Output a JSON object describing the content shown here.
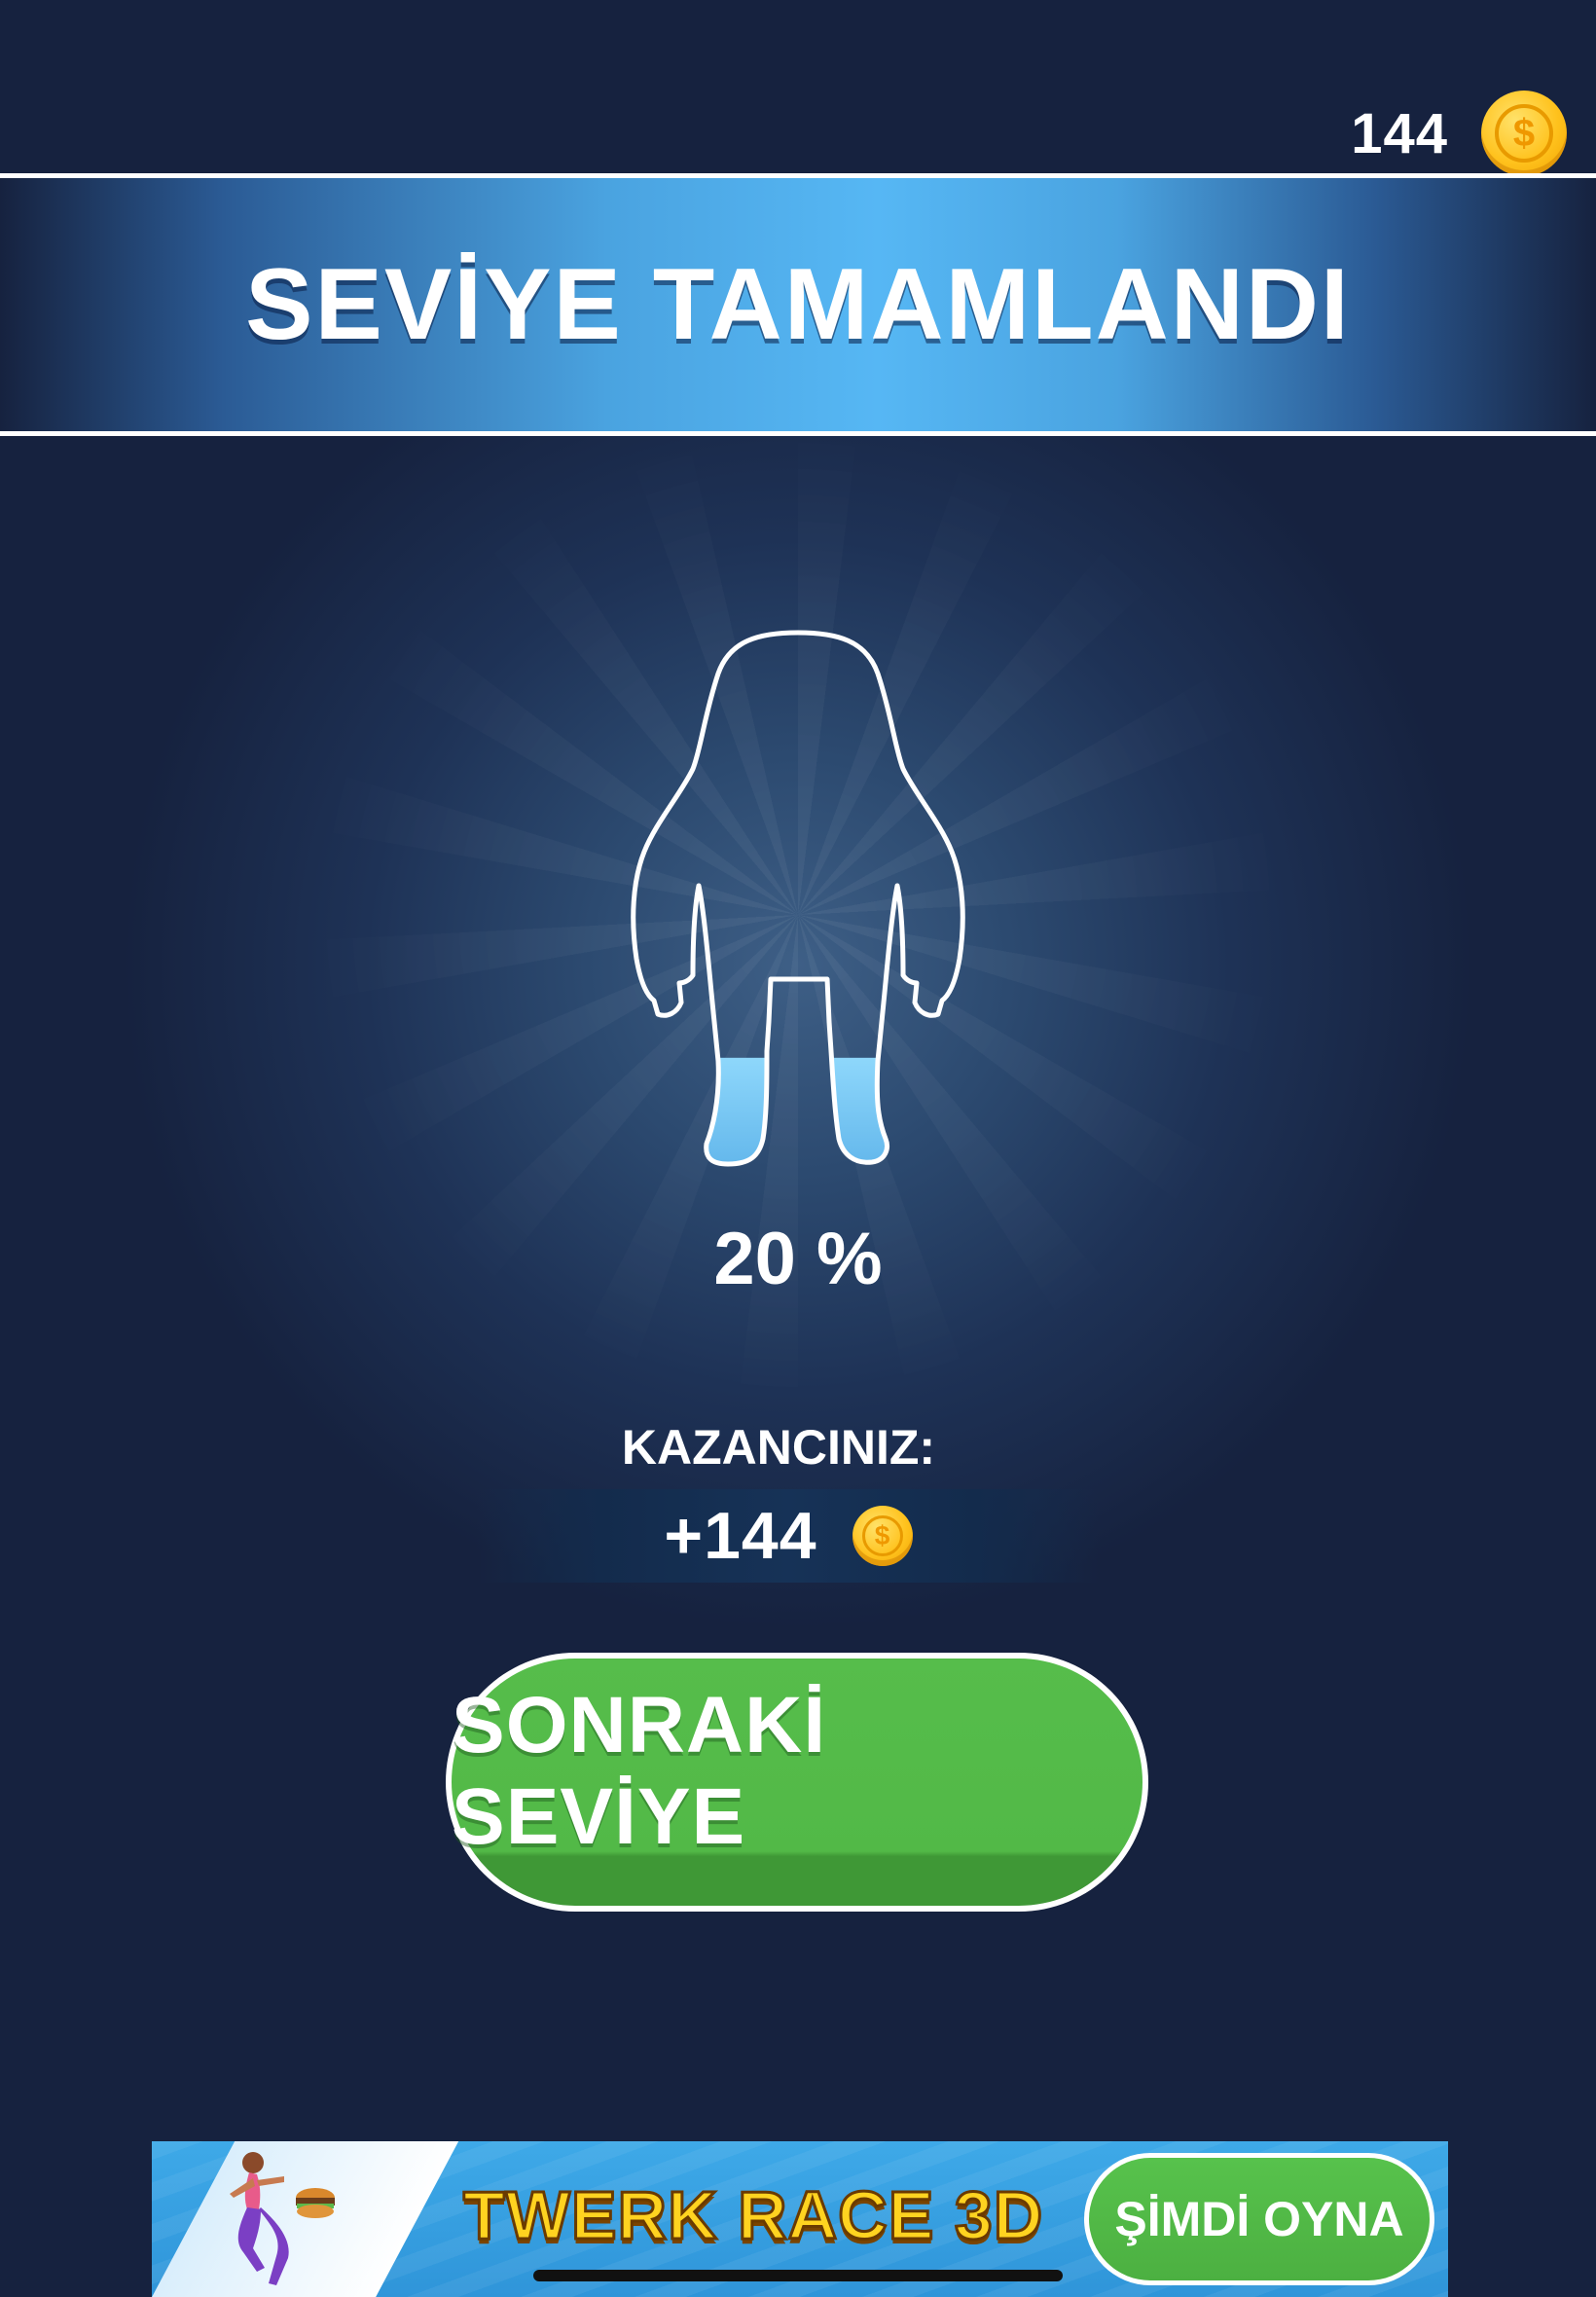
{
  "header": {
    "coin_count": "144",
    "coin_icon": "coin-icon"
  },
  "banner": {
    "title": "SEVİYE TAMAMLANDI"
  },
  "progress": {
    "percent_text": "20 %",
    "fill_fraction": 0.2
  },
  "reward": {
    "label": "KAZANCINIZ:",
    "amount": "+144"
  },
  "next_button": {
    "label": "SONRAKİ SEVİYE"
  },
  "ad": {
    "title": "TWERK RACE 3D",
    "cta_label": "ŞİMDİ OYNA"
  },
  "colors": {
    "background": "#16223f",
    "banner_accent": "#56b7f4",
    "button_green": "#52b947",
    "fill_blue": "#7ecbf4",
    "coin_gold": "#ffc21d"
  }
}
